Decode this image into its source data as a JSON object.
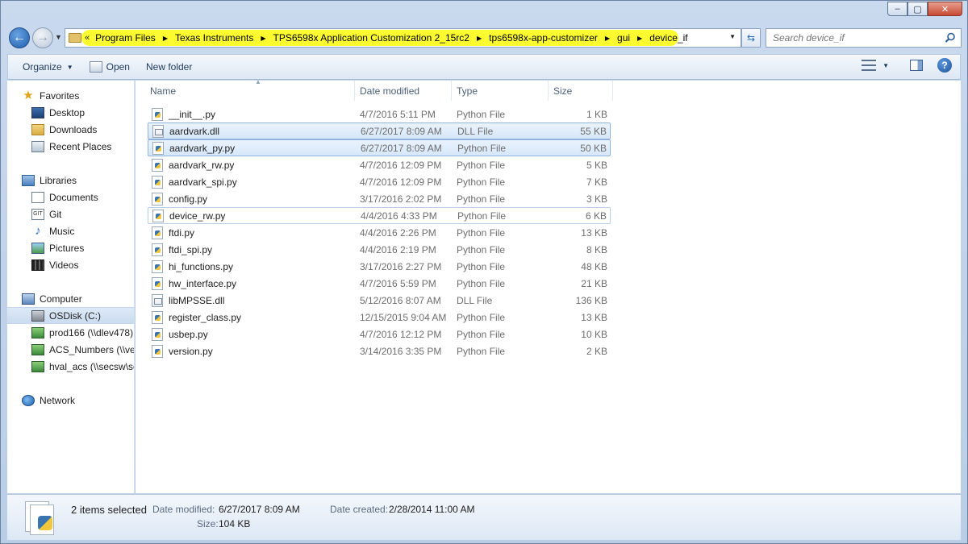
{
  "window": {
    "caption": {
      "minimize": "‒",
      "maximize": "▢",
      "close": "✕"
    }
  },
  "address": {
    "lead": "«",
    "crumbs": [
      "Program Files",
      "Texas Instruments",
      "TPS6598x Application Customization 2_15rc2",
      "tps6598x-app-customizer",
      "gui",
      "device_if"
    ],
    "highlight_color": "#fbfb30"
  },
  "search": {
    "placeholder": "Search device_if"
  },
  "toolbar": {
    "organize": "Organize",
    "open": "Open",
    "new_folder": "New folder"
  },
  "nav": {
    "favorites": "Favorites",
    "desktop": "Desktop",
    "downloads": "Downloads",
    "recent_places": "Recent Places",
    "libraries": "Libraries",
    "documents": "Documents",
    "git": "Git",
    "git_icon": "GIT",
    "music": "Music",
    "pictures": "Pictures",
    "videos": "Videos",
    "computer": "Computer",
    "osdisk": "OSDisk (C:)",
    "prod166": "prod166 (\\\\dlev478)",
    "acs_numbers": "ACS_Numbers (\\\\ve",
    "hval_acs": "hval_acs (\\\\secsw\\se",
    "network": "Network"
  },
  "columns": {
    "name": "Name",
    "date_modified": "Date modified",
    "type": "Type",
    "size": "Size"
  },
  "files": [
    {
      "name": "__init__.py",
      "date": "4/7/2016 5:11 PM",
      "type": "Python File",
      "size": "1 KB"
    },
    {
      "name": "aardvark.dll",
      "date": "6/27/2017 8:09 AM",
      "type": "DLL File",
      "size": "55 KB"
    },
    {
      "name": "aardvark_py.py",
      "date": "6/27/2017 8:09 AM",
      "type": "Python File",
      "size": "50 KB"
    },
    {
      "name": "aardvark_rw.py",
      "date": "4/7/2016 12:09 PM",
      "type": "Python File",
      "size": "5 KB"
    },
    {
      "name": "aardvark_spi.py",
      "date": "4/7/2016 12:09 PM",
      "type": "Python File",
      "size": "7 KB"
    },
    {
      "name": "config.py",
      "date": "3/17/2016 2:02 PM",
      "type": "Python File",
      "size": "3 KB"
    },
    {
      "name": "device_rw.py",
      "date": "4/4/2016 4:33 PM",
      "type": "Python File",
      "size": "6 KB"
    },
    {
      "name": "ftdi.py",
      "date": "4/4/2016 2:26 PM",
      "type": "Python File",
      "size": "13 KB"
    },
    {
      "name": "ftdi_spi.py",
      "date": "4/4/2016 2:19 PM",
      "type": "Python File",
      "size": "8 KB"
    },
    {
      "name": "hi_functions.py",
      "date": "3/17/2016 2:27 PM",
      "type": "Python File",
      "size": "48 KB"
    },
    {
      "name": "hw_interface.py",
      "date": "4/7/2016 5:59 PM",
      "type": "Python File",
      "size": "21 KB"
    },
    {
      "name": "libMPSSE.dll",
      "date": "5/12/2016 8:07 AM",
      "type": "DLL File",
      "size": "136 KB"
    },
    {
      "name": "register_class.py",
      "date": "12/15/2015 9:04 AM",
      "type": "Python File",
      "size": "13 KB"
    },
    {
      "name": "usbep.py",
      "date": "4/7/2016 12:12 PM",
      "type": "Python File",
      "size": "10 KB"
    },
    {
      "name": "version.py",
      "date": "3/14/2016 3:35 PM",
      "type": "Python File",
      "size": "2 KB"
    }
  ],
  "details": {
    "count": "2 items selected",
    "date_modified_label": "Date modified:",
    "date_modified_value": "6/27/2017 8:09 AM",
    "date_created_label": "Date created:",
    "date_created_value": "2/28/2014 11:00 AM",
    "size_label": "Size:",
    "size_value": "104 KB"
  }
}
